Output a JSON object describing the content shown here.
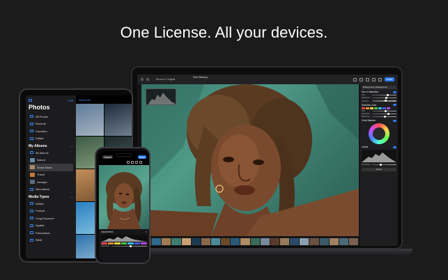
{
  "headline": "One License. All your devices.",
  "mac": {
    "toolbar": {
      "revert_label": "Revert to Original",
      "title": "Semi Barbary",
      "subtitle": "",
      "done_label": "Done"
    },
    "panel": {
      "preset_label": "Background | Background",
      "sections": [
        "Hue & Saturation",
        "Selective Color",
        "Color Balance",
        "Levels"
      ],
      "sliders": [
        "Hue",
        "Saturation",
        "Vibrance",
        "Hue",
        "Saturation",
        "Brightness",
        "Smoothing"
      ],
      "reset_label": "Reset"
    }
  },
  "ipad": {
    "edit_label": "Edit",
    "select_all_label": "Select All",
    "title": "Photos",
    "library_items": [
      "All Photos",
      "Recents",
      "Favorites",
      "Edited"
    ],
    "albums_header": "My Albums",
    "album_items": [
      "All Albums",
      "Nature",
      "Great Shots",
      "Travel",
      "Lifestyle",
      "New Album"
    ],
    "media_header": "Media Types",
    "media_items": [
      "Selfies",
      "Portrait",
      "Long Exposure",
      "Spatial",
      "Panoramas",
      "RAW"
    ]
  },
  "iphone": {
    "cancel_label": "Cancel",
    "done_label": "Done",
    "adjustments_label": "Adjustments",
    "slider_label": "Saturation"
  },
  "colors": {
    "accent": "#2b7cf6",
    "background": "#1b1b1c",
    "photo_bg": "#4f9a88"
  }
}
